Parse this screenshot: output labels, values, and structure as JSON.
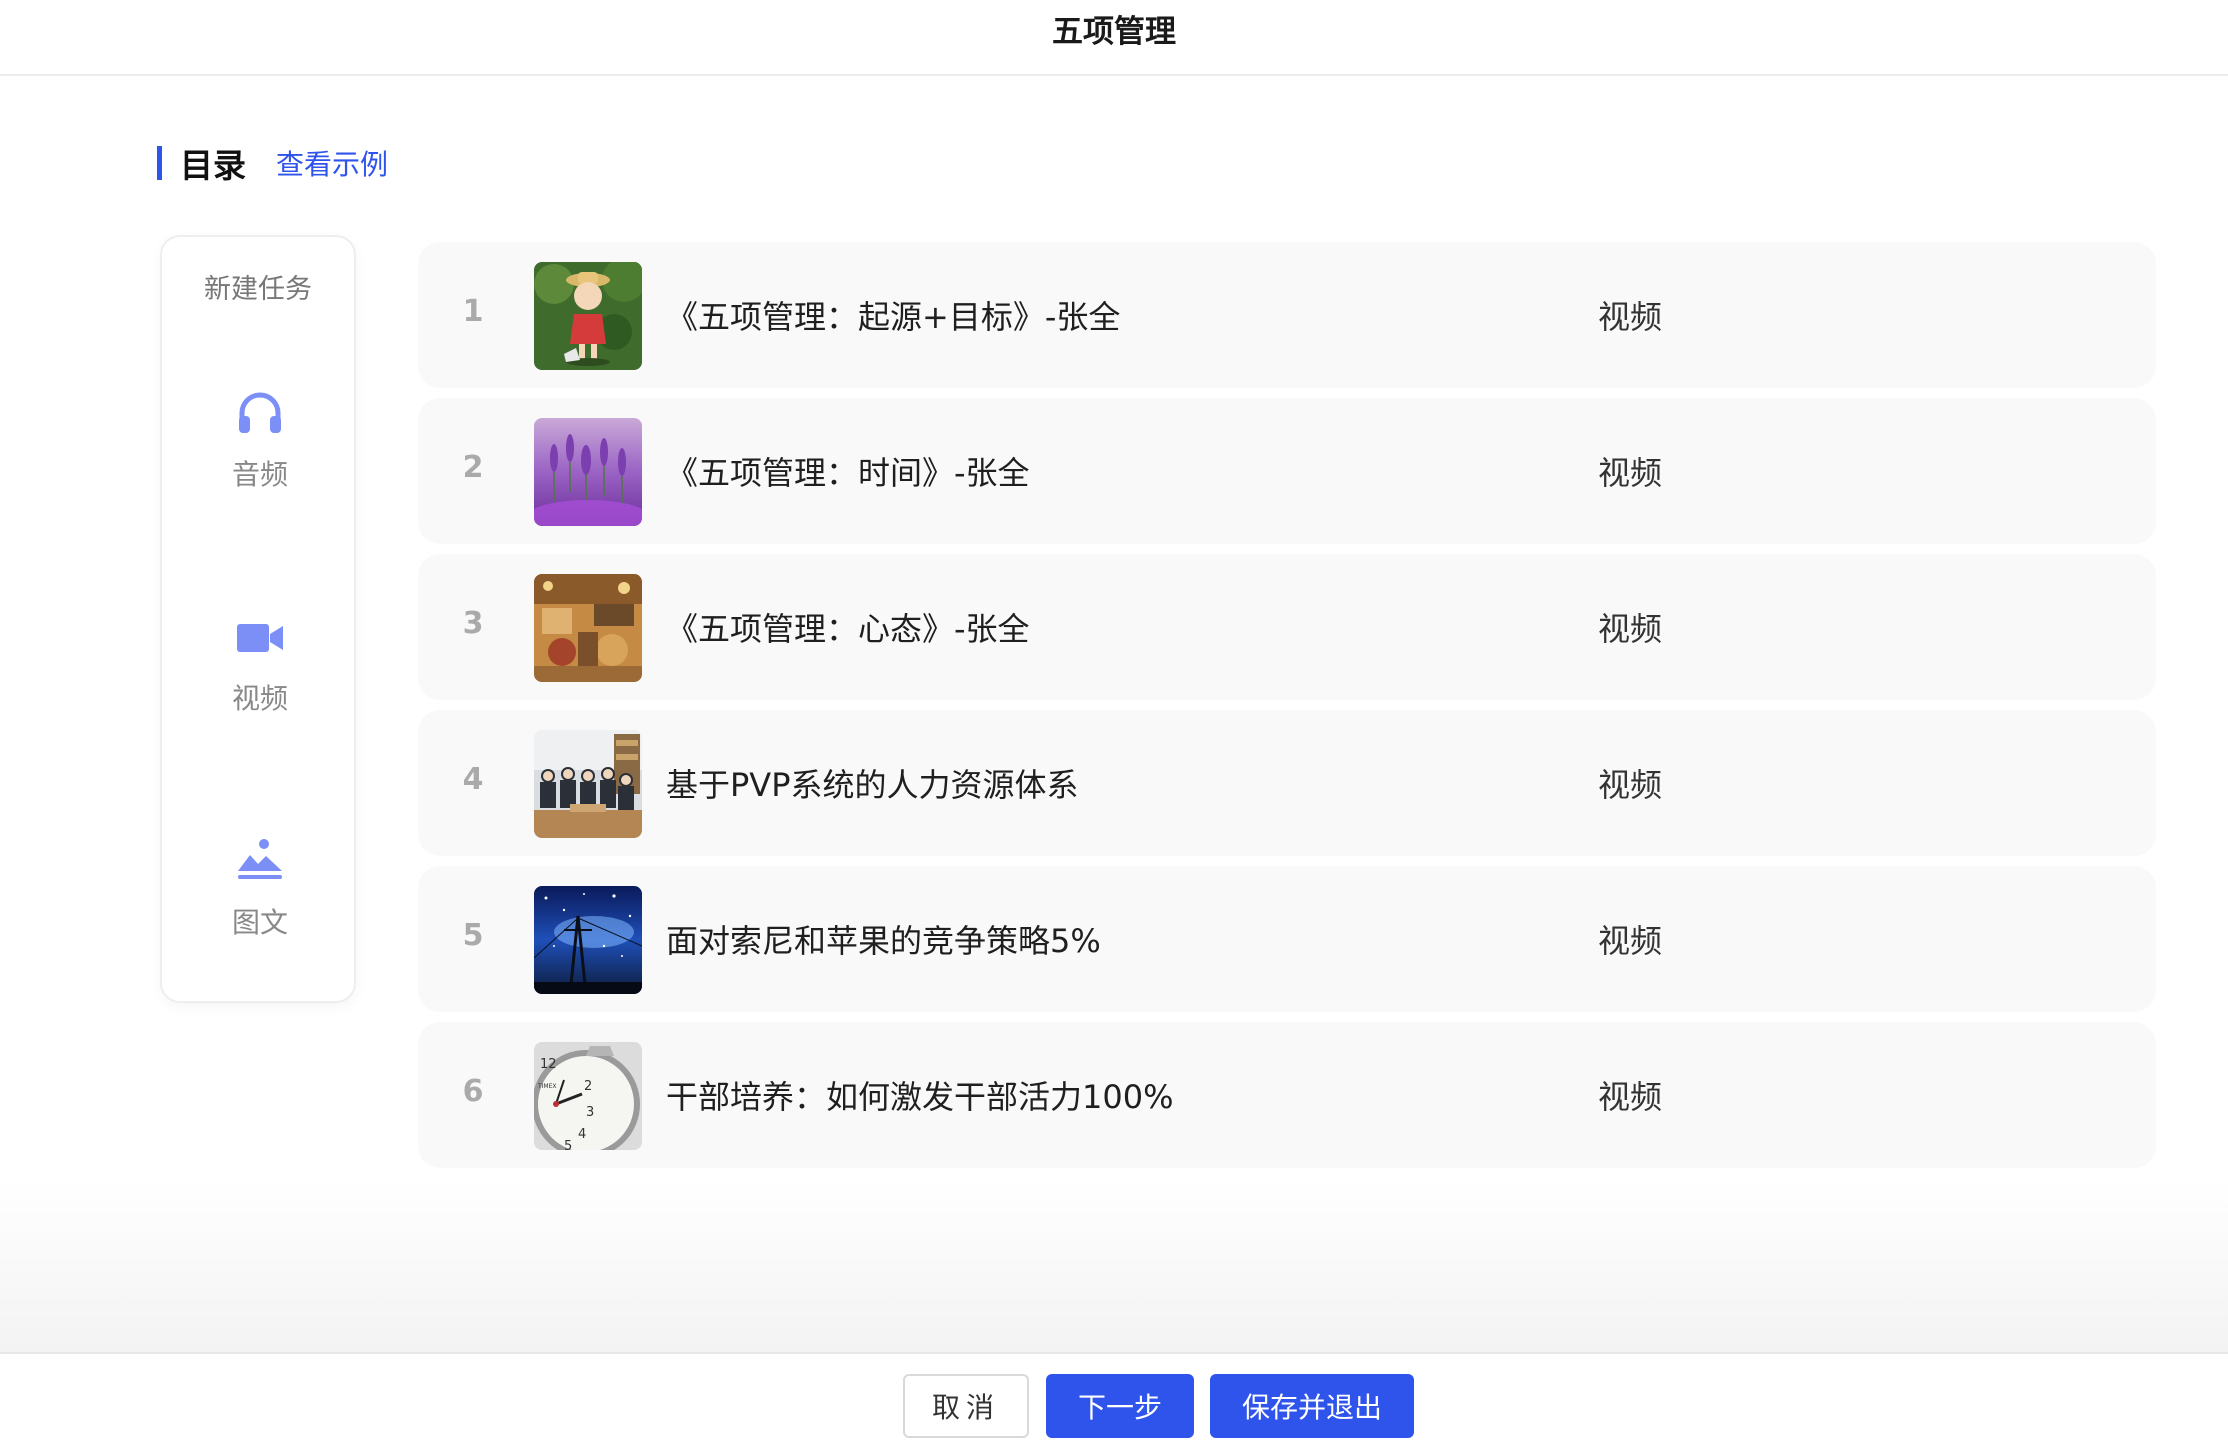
{
  "header": {
    "title": "五项管理"
  },
  "section": {
    "title": "目录",
    "example_link": "查看示例"
  },
  "tool_panel": {
    "title": "新建任务",
    "tools": [
      {
        "label": "音频",
        "icon": "headphones-icon"
      },
      {
        "label": "视频",
        "icon": "video-camera-icon"
      },
      {
        "label": "图文",
        "icon": "image-text-icon"
      }
    ]
  },
  "tasks": [
    {
      "index": "1",
      "title": "《五项管理：起源+目标》-张全",
      "type": "视频"
    },
    {
      "index": "2",
      "title": "《五项管理：时间》-张全",
      "type": "视频"
    },
    {
      "index": "3",
      "title": "《五项管理：心态》-张全",
      "type": "视频"
    },
    {
      "index": "4",
      "title": "基于PVP系统的人力资源体系",
      "type": "视频"
    },
    {
      "index": "5",
      "title": "面对索尼和苹果的竞争策略5%",
      "type": "视频"
    },
    {
      "index": "6",
      "title": "干部培养：如何激发干部活力100%",
      "type": "视频"
    }
  ],
  "footer": {
    "cancel": "取消",
    "next": "下一步",
    "save_exit": "保存并退出"
  },
  "colors": {
    "accent": "#2f54eb",
    "icon": "#7b8ff7"
  }
}
